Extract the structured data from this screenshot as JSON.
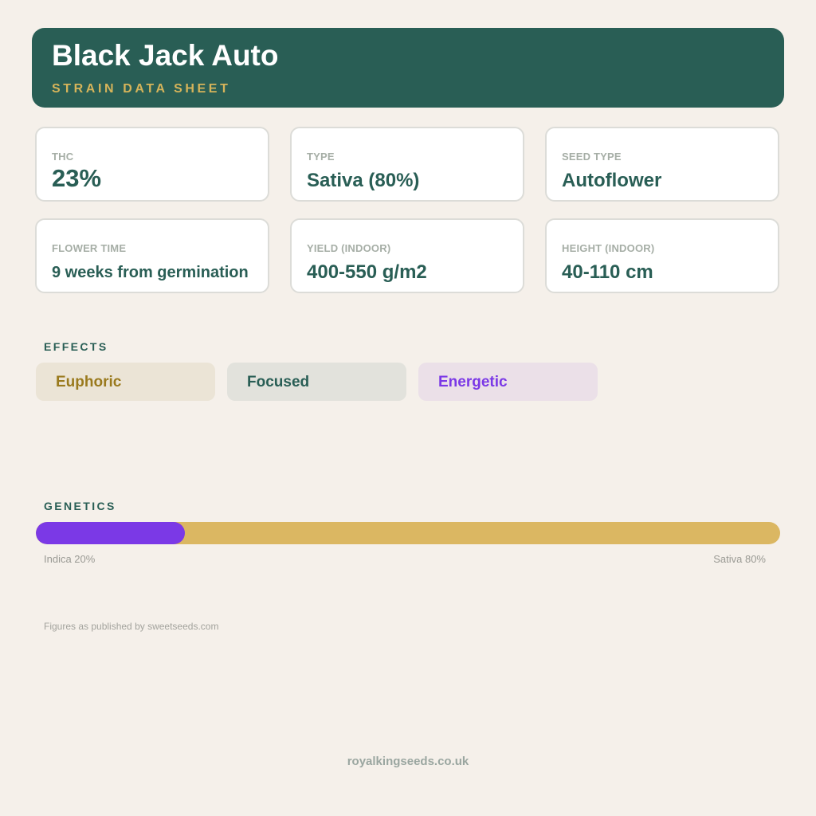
{
  "header": {
    "title": "Black Jack Auto",
    "subtitle": "STRAIN DATA SHEET"
  },
  "stats": [
    {
      "label": "THC",
      "value": "23%"
    },
    {
      "label": "TYPE",
      "value": "Sativa (80%)"
    },
    {
      "label": "SEED TYPE",
      "value": "Autoflower"
    },
    {
      "label": "FLOWER TIME",
      "value": "9 weeks from germination"
    },
    {
      "label": "YIELD (INDOOR)",
      "value": "400-550 g/m2"
    },
    {
      "label": "HEIGHT (INDOOR)",
      "value": "40-110 cm"
    }
  ],
  "effects": {
    "title": "EFFECTS",
    "items": [
      {
        "label": "Euphoric",
        "color": "#9a7a1e",
        "bg": "#ebe4d6"
      },
      {
        "label": "Focused",
        "color": "#295e55",
        "bg": "#e2e2dc"
      },
      {
        "label": "Energetic",
        "color": "#7b39e6",
        "bg": "#ebe0e8"
      }
    ]
  },
  "genetics": {
    "title": "GENETICS",
    "indica_label": "Indica 20%",
    "sativa_label": "Sativa 80%",
    "indica_fraction": 0.2,
    "indica_color": "#7b39e6",
    "sativa_color": "#dbb762"
  },
  "source_note": "Figures as published by sweetseeds.com",
  "footer": "royalkingseeds.co.uk",
  "colors": {
    "accent": "#295e55",
    "gold": "#d6b45a",
    "background": "#f5f0ea"
  }
}
